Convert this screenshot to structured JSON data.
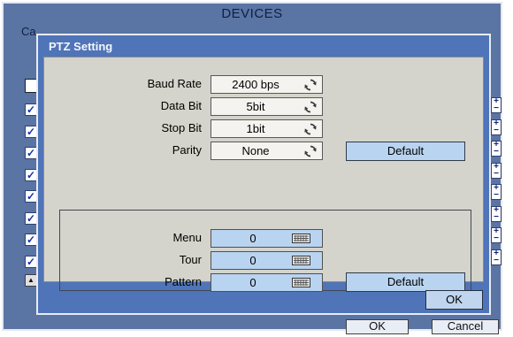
{
  "background_window": {
    "title": "DEVICES",
    "partial_label": "Ca",
    "checked_rows": 8,
    "scroll_arrow": "▲",
    "plus_sign": "+",
    "minus_sign": "−",
    "ok_label": "OK",
    "cancel_label": "Cancel"
  },
  "dialog": {
    "title": "PTZ Setting",
    "settings": {
      "baud_rate_label": "Baud Rate",
      "baud_rate_value": "2400 bps",
      "data_bit_label": "Data Bit",
      "data_bit_value": "5bit",
      "stop_bit_label": "Stop Bit",
      "stop_bit_value": "1bit",
      "parity_label": "Parity",
      "parity_value": "None",
      "default_label": "Default"
    },
    "presets": {
      "menu_label": "Menu",
      "menu_value": "0",
      "tour_label": "Tour",
      "tour_value": "0",
      "pattern_label": "Pattern",
      "pattern_value": "0",
      "default_label": "Default"
    },
    "ok_label": "OK"
  },
  "icons": {
    "spin": "refresh-icon",
    "keyboard": "keyboard-icon"
  },
  "colors": {
    "dialog_frame": "#4f74b8",
    "panel": "#d5d4cc",
    "field_highlight": "#b9d4f0",
    "check_mark": "#1030b0"
  }
}
